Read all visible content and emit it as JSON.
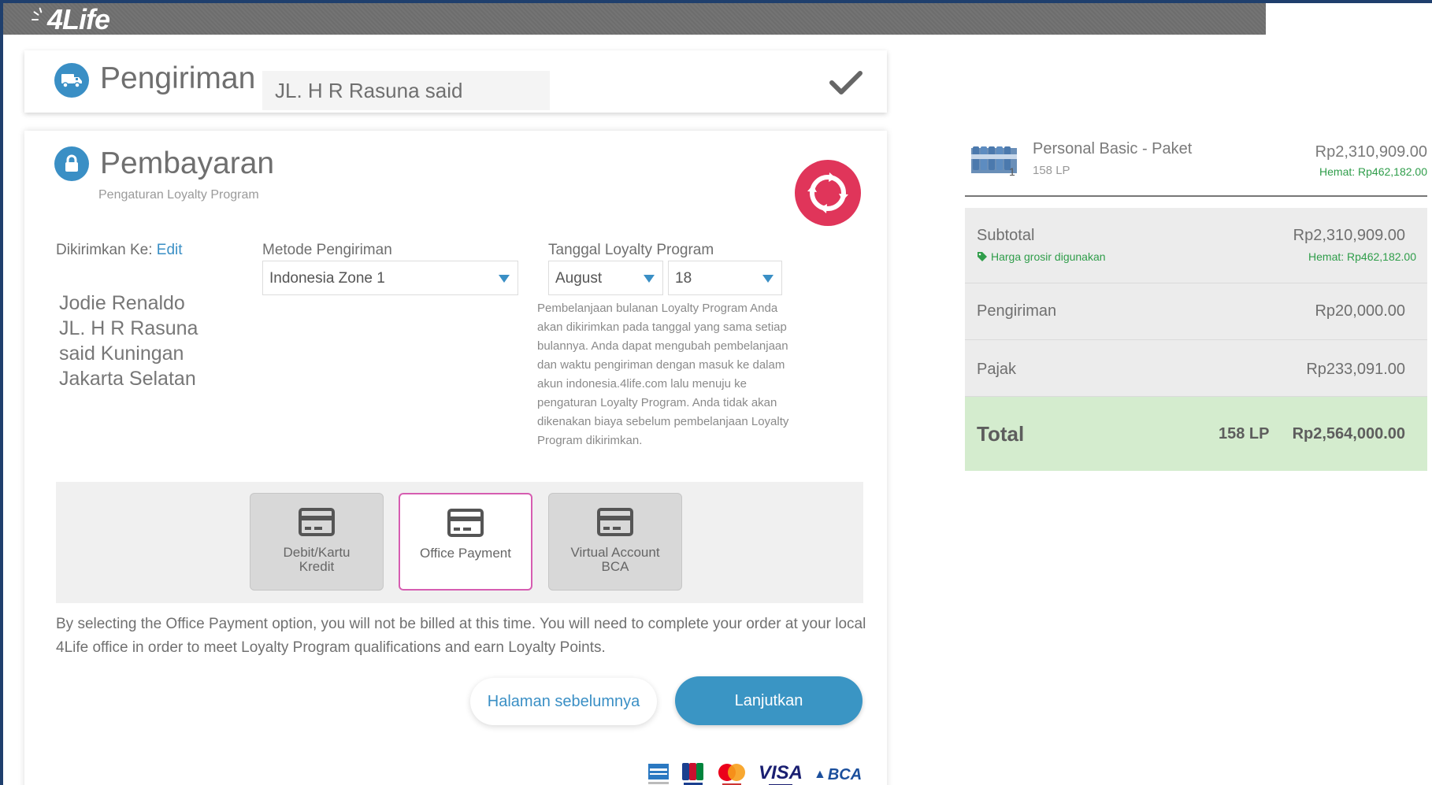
{
  "brand": {
    "logo_text": "4Life",
    "accent": "#3a8fc5",
    "pink": "#e0355a",
    "green": "#2f9d4a"
  },
  "shipping": {
    "title": "Pengiriman",
    "address_summary": "JL. H R Rasuna said"
  },
  "payment": {
    "title": "Pembayaran",
    "subtitle": "Pengaturan Loyalty Program",
    "ship_to_label": "Dikirimkan Ke:",
    "edit_label": "Edit",
    "address_lines": [
      "Jodie Renaldo",
      "JL. H R Rasuna",
      "said Kuningan",
      "Jakarta Selatan"
    ],
    "method_label": "Metode Pengiriman",
    "method_value": "Indonesia Zone 1",
    "date_label": "Tanggal Loyalty Program",
    "month_value": "August",
    "day_value": "18",
    "info_text": "Pembelanjaan bulanan Loyalty Program Anda akan dikirimkan pada tanggal yang sama setiap bulannya. Anda dapat mengubah pembelanjaan dan waktu pengiriman dengan masuk ke dalam akun indonesia.4life.com lalu menuju ke pengaturan Loyalty Program. Anda tidak akan dikenakan biaya sebelum pembelanjaan Loyalty Program dikirimkan.",
    "options": [
      {
        "label": "Debit/Kartu Kredit"
      },
      {
        "label": "Office Payment"
      },
      {
        "label": "Virtual Account BCA"
      }
    ],
    "notice": "By selecting the Office Payment option, you will not be billed at this time. You will need to complete your order at your local 4Life office in order to meet Loyalty Program qualifications and earn Loyalty Points.",
    "prev_label": "Halaman sebelumnya",
    "next_label": "Lanjutkan",
    "card_brands": {
      "visa": "VISA",
      "bca": "BCA"
    }
  },
  "summary": {
    "product": {
      "name": "Personal Basic - Paket",
      "lp": "158 LP",
      "qty": "1",
      "price": "Rp2,310,909.00",
      "savings": "Hemat: Rp462,182.00"
    },
    "subtotal_label": "Subtotal",
    "subtotal_value": "Rp2,310,909.00",
    "wholesale_note": "Harga grosir digunakan",
    "subtotal_savings": "Hemat: Rp462,182.00",
    "shipping_label": "Pengiriman",
    "shipping_value": "Rp20,000.00",
    "tax_label": "Pajak",
    "tax_value": "Rp233,091.00",
    "total_label": "Total",
    "total_lp": "158 LP",
    "total_value": "Rp2,564,000.00"
  }
}
